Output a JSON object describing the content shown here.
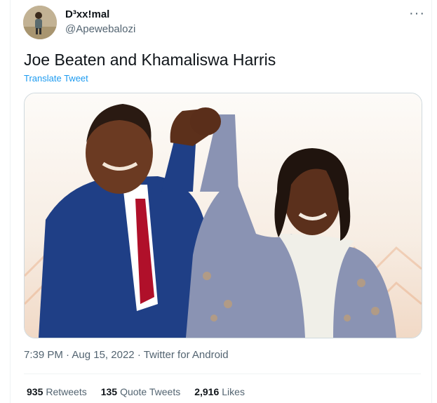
{
  "tweet": {
    "display_name": "D³xx!mal",
    "handle": "@Apewebalozi",
    "text": "Joe Beaten and Khamaliswa Harris",
    "translate_label": "Translate Tweet",
    "more_icon": "more-horizontal-icon"
  },
  "meta": {
    "time": "7:39 PM",
    "separator": "·",
    "date": "Aug 15, 2022",
    "source": "Twitter for Android"
  },
  "stats": {
    "retweets_count": "935",
    "retweets_label": "Retweets",
    "quotes_count": "135",
    "quotes_label": "Quote Tweets",
    "likes_count": "2,916",
    "likes_label": "Likes"
  },
  "colors": {
    "link": "#1d9bf0",
    "secondary_text": "#536471",
    "border": "#cfd9de"
  }
}
